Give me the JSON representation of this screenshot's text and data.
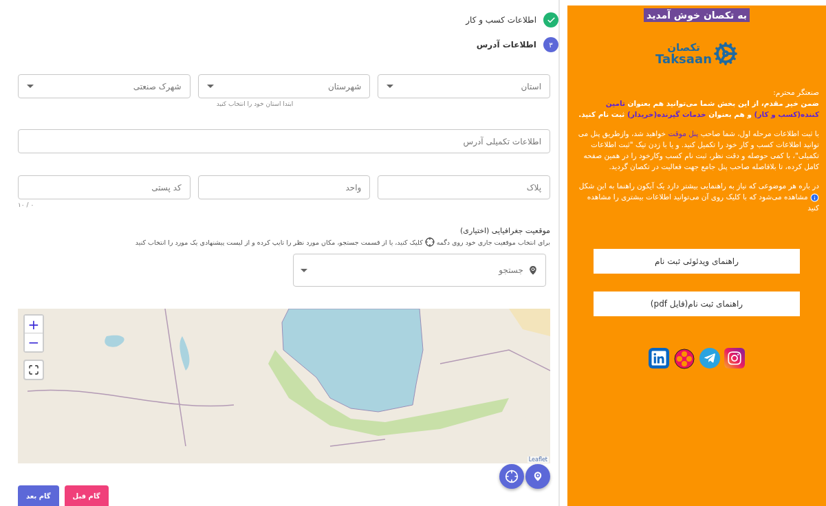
{
  "steps": [
    {
      "label": "اطلاعات کسب و کار",
      "completed": true,
      "selected": false
    },
    {
      "label": "اطلاعات آدرس",
      "number": "۳",
      "completed": false,
      "selected": true
    }
  ],
  "form_rows": [
    [
      {
        "kind": "select",
        "placeholder": "استان"
      },
      {
        "kind": "select",
        "placeholder": "شهرستان",
        "hint": "ابتدا استان خود را انتخاب کنید"
      },
      {
        "kind": "select",
        "placeholder": "شهرک صنعتی"
      }
    ],
    [
      {
        "kind": "text",
        "placeholder": "اطلاعات تکمیلی آدرس"
      }
    ],
    [
      {
        "kind": "text",
        "placeholder": "پلاک"
      },
      {
        "kind": "text",
        "placeholder": "واحد"
      },
      {
        "kind": "text",
        "placeholder": "کد پستی",
        "counter": "۱۰ / ۰"
      }
    ]
  ],
  "geo": {
    "title": "موقعیت جغرافیایی (اختیاری)",
    "help_before": "برای انتخاب موقعیت جاری خود روی دگمه",
    "help_after": "کلیک کنید، یا از قسمت جستجو، مکان مورد نظر را تایپ کرده و از لیست پیشنهادی یک مورد را انتخاب کنید",
    "search_placeholder": "جستجو"
  },
  "map": {
    "zoom_in": "+",
    "zoom_out": "−",
    "attribution": "Leaflet"
  },
  "buttons": [
    {
      "label": "گام قبل",
      "kind": "previous"
    },
    {
      "label": "گام بعد",
      "kind": "next"
    }
  ],
  "sidebar": {
    "welcome": "به تکصان خوش آمدید",
    "logo": {
      "fa": "تکصان",
      "en": "Taksaan"
    },
    "paragraphs": [
      {
        "bold": false,
        "segments": [
          {
            "text": "صنعتگر محترم:",
            "highlight": false
          }
        ]
      },
      {
        "bold": true,
        "segments": [
          {
            "text": "ضمن خیر مقدم، از این بخش شما می‌توانید هم بعنوان ",
            "highlight": false
          },
          {
            "text": "تامین کننده(کسب و کار)",
            "highlight": true
          },
          {
            "text": " و هم بعنوان ",
            "highlight": false
          },
          {
            "text": "خدمات گیرنده(خریدار)",
            "highlight": true
          },
          {
            "text": " ثبت نام کنید.",
            "highlight": false
          }
        ]
      },
      {
        "bold": false,
        "segments": [
          {
            "text": "با ثبت اطلاعات مرحله اول، شما صاحب ",
            "highlight": false
          },
          {
            "text": "پنل موقت",
            "highlight": true
          },
          {
            "text": " خواهید شد، وازطریق پنل می توانید اطلاعات کسب و کار خود را تکمیل کنید. و یا با زدن تیک \"ثبت اطلاعات تکمیلی\"، با کمی حوصله و دقت نظر، ثبت نام کسب وکارخود را در همین صفحه کامل کرده، تا بلافاصله صاحب پنل جامع جهت فعالیت در تکصان گردید.",
            "highlight": false
          }
        ]
      },
      {
        "bold": false,
        "info_icon": true,
        "segments": [
          {
            "text": "در باره هر موضوعی که نیاز به راهنمایی بیشتر دارد یک آیکون راهنما به این شکل",
            "highlight": false
          },
          {
            "text": " مشاهده می‌شود که با کلیک روی آن می‌توانید اطلاعات بیشتری را مشاهده کنید",
            "highlight": false
          }
        ]
      }
    ],
    "guide_buttons": [
      "راهنمای ویدئوئی ثبت نام",
      "راهنمای ثبت نام(فایل pdf)"
    ]
  }
}
